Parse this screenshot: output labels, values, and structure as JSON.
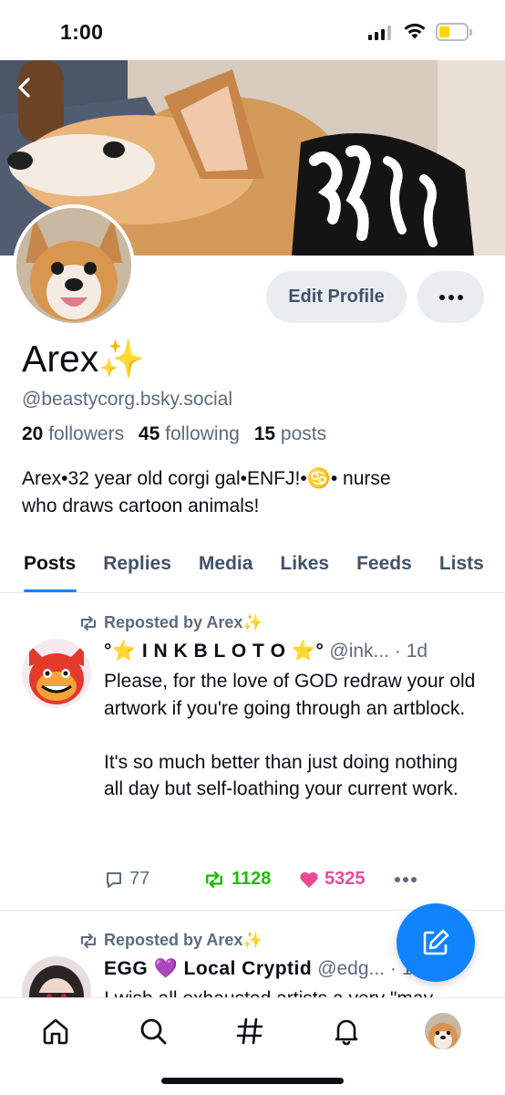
{
  "status_bar": {
    "time": "1:00"
  },
  "profile": {
    "display_name": "Arex✨",
    "handle": "@beastycorg.bsky.social",
    "followers_count": "20",
    "followers_label": "followers",
    "following_count": "45",
    "following_label": "following",
    "posts_count": "15",
    "posts_label": "posts",
    "bio_line1": "Arex•32 year old corgi gal•ENFJ!•♋️• nurse",
    "bio_line2": "who draws cartoon animals!",
    "edit_profile_label": "Edit Profile"
  },
  "tabs": [
    "Posts",
    "Replies",
    "Media",
    "Likes",
    "Feeds",
    "Lists"
  ],
  "active_tab": "Posts",
  "posts": [
    {
      "repost_label": "Reposted by Arex✨",
      "author_name": "°⭐ I N K B L O T O ⭐°",
      "author_meta": "@ink... · 1d",
      "text": "Please, for the love of GOD redraw your old artwork if you're going through an artblock.\n\nIt's so much better than just doing nothing all day but self-loathing your current work.",
      "replies": "77",
      "reposts": "1128",
      "likes": "5325"
    },
    {
      "repost_label": "Reposted by Arex✨",
      "author_name": "EGG 💜 Local Cryptid",
      "author_meta": "@edg... · 10d",
      "text": "I wish all exhausted artists a very \"may"
    }
  ],
  "icons": {
    "back": "chevron-left-icon",
    "more": "ellipsis-icon",
    "repost": "repost-icon",
    "reply": "comment-icon",
    "like": "heart-icon",
    "compose": "compose-icon",
    "nav": [
      "home-icon",
      "search-icon",
      "hashtag-icon",
      "bell-icon",
      "avatar"
    ]
  },
  "colors": {
    "accent": "#1083fe",
    "repost_active": "#20bc07",
    "like_active": "#ec4899",
    "muted": "#5c6b80"
  }
}
